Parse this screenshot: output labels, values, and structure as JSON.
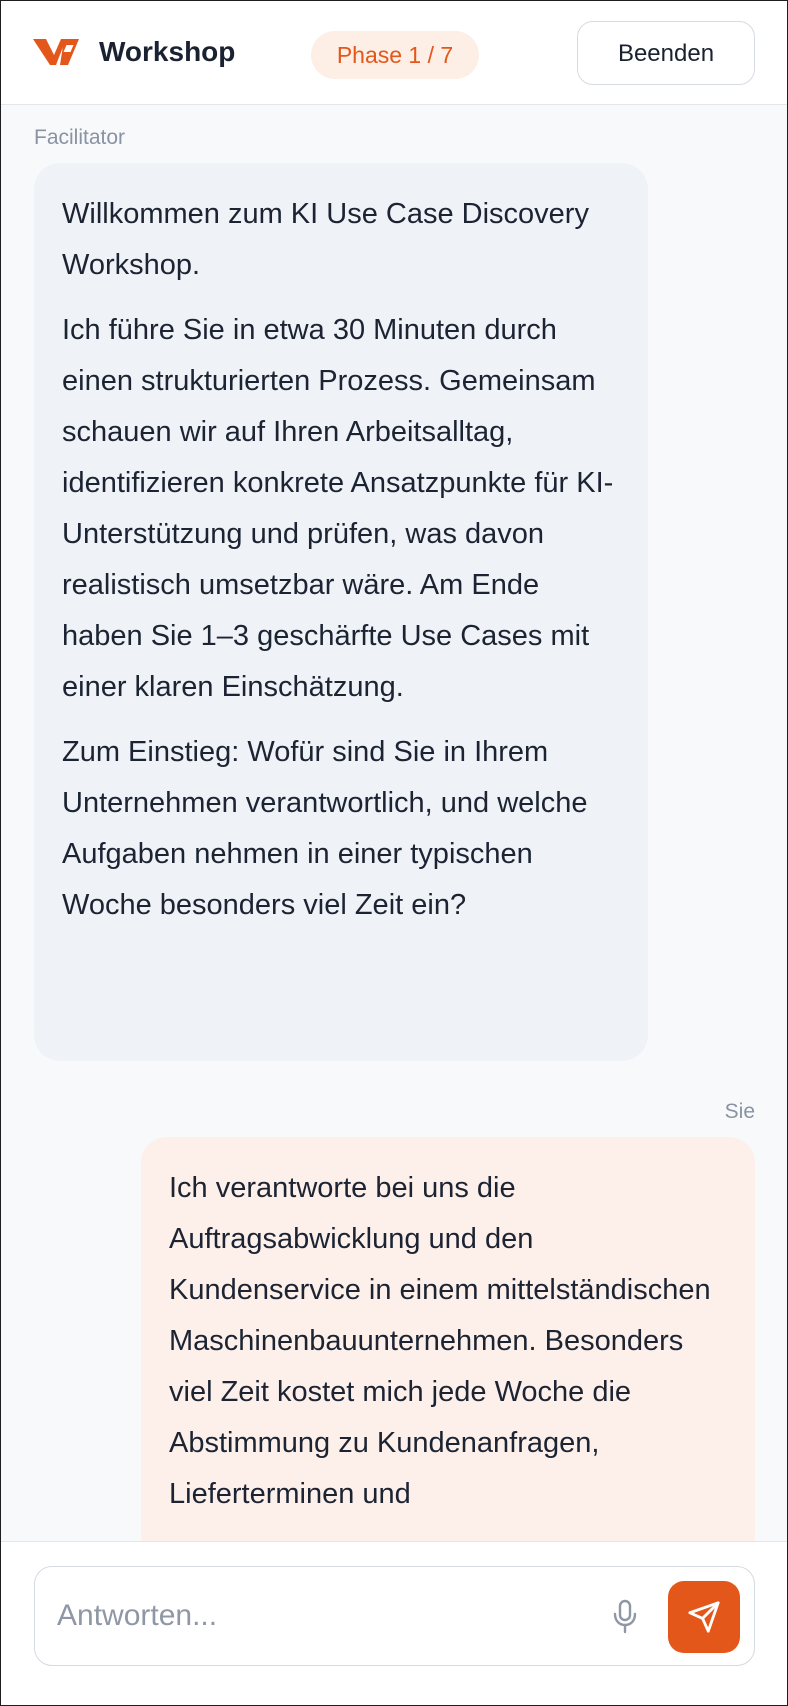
{
  "header": {
    "title": "Workshop",
    "phase": "Phase 1 / 7",
    "end_label": "Beenden",
    "brand_color": "#e4571a"
  },
  "messages": [
    {
      "sender": "Facilitator",
      "paragraphs": [
        "Willkommen zum KI Use Case Discovery Workshop.",
        "Ich führe Sie in etwa 30 Minuten durch einen strukturierten Prozess. Gemeinsam schauen wir auf Ihren Arbeitsalltag, identifizieren konkrete Ansatzpunkte für KI-Unterstützung und prüfen, was davon realistisch umsetzbar wäre. Am Ende haben Sie 1–3 geschärfte Use Cases mit einer klaren Einschätzung.",
        "Zum Einstieg: Wofür sind Sie in Ihrem Unternehmen verantwortlich, und welche Aufgaben nehmen in einer typischen Woche besonders viel Zeit ein?"
      ]
    },
    {
      "sender": "Sie",
      "text": "Ich verantworte bei uns die Auftragsabwicklung und den Kundenservice in einem mittelständischen Maschinenbauunternehmen. Besonders viel Zeit kostet mich jede Woche die Abstimmung zu Kundenanfragen, Lieferterminen und"
    }
  ],
  "composer": {
    "placeholder": "Antworten...",
    "value": "",
    "mic_icon": "microphone-icon",
    "send_icon": "send-icon"
  }
}
